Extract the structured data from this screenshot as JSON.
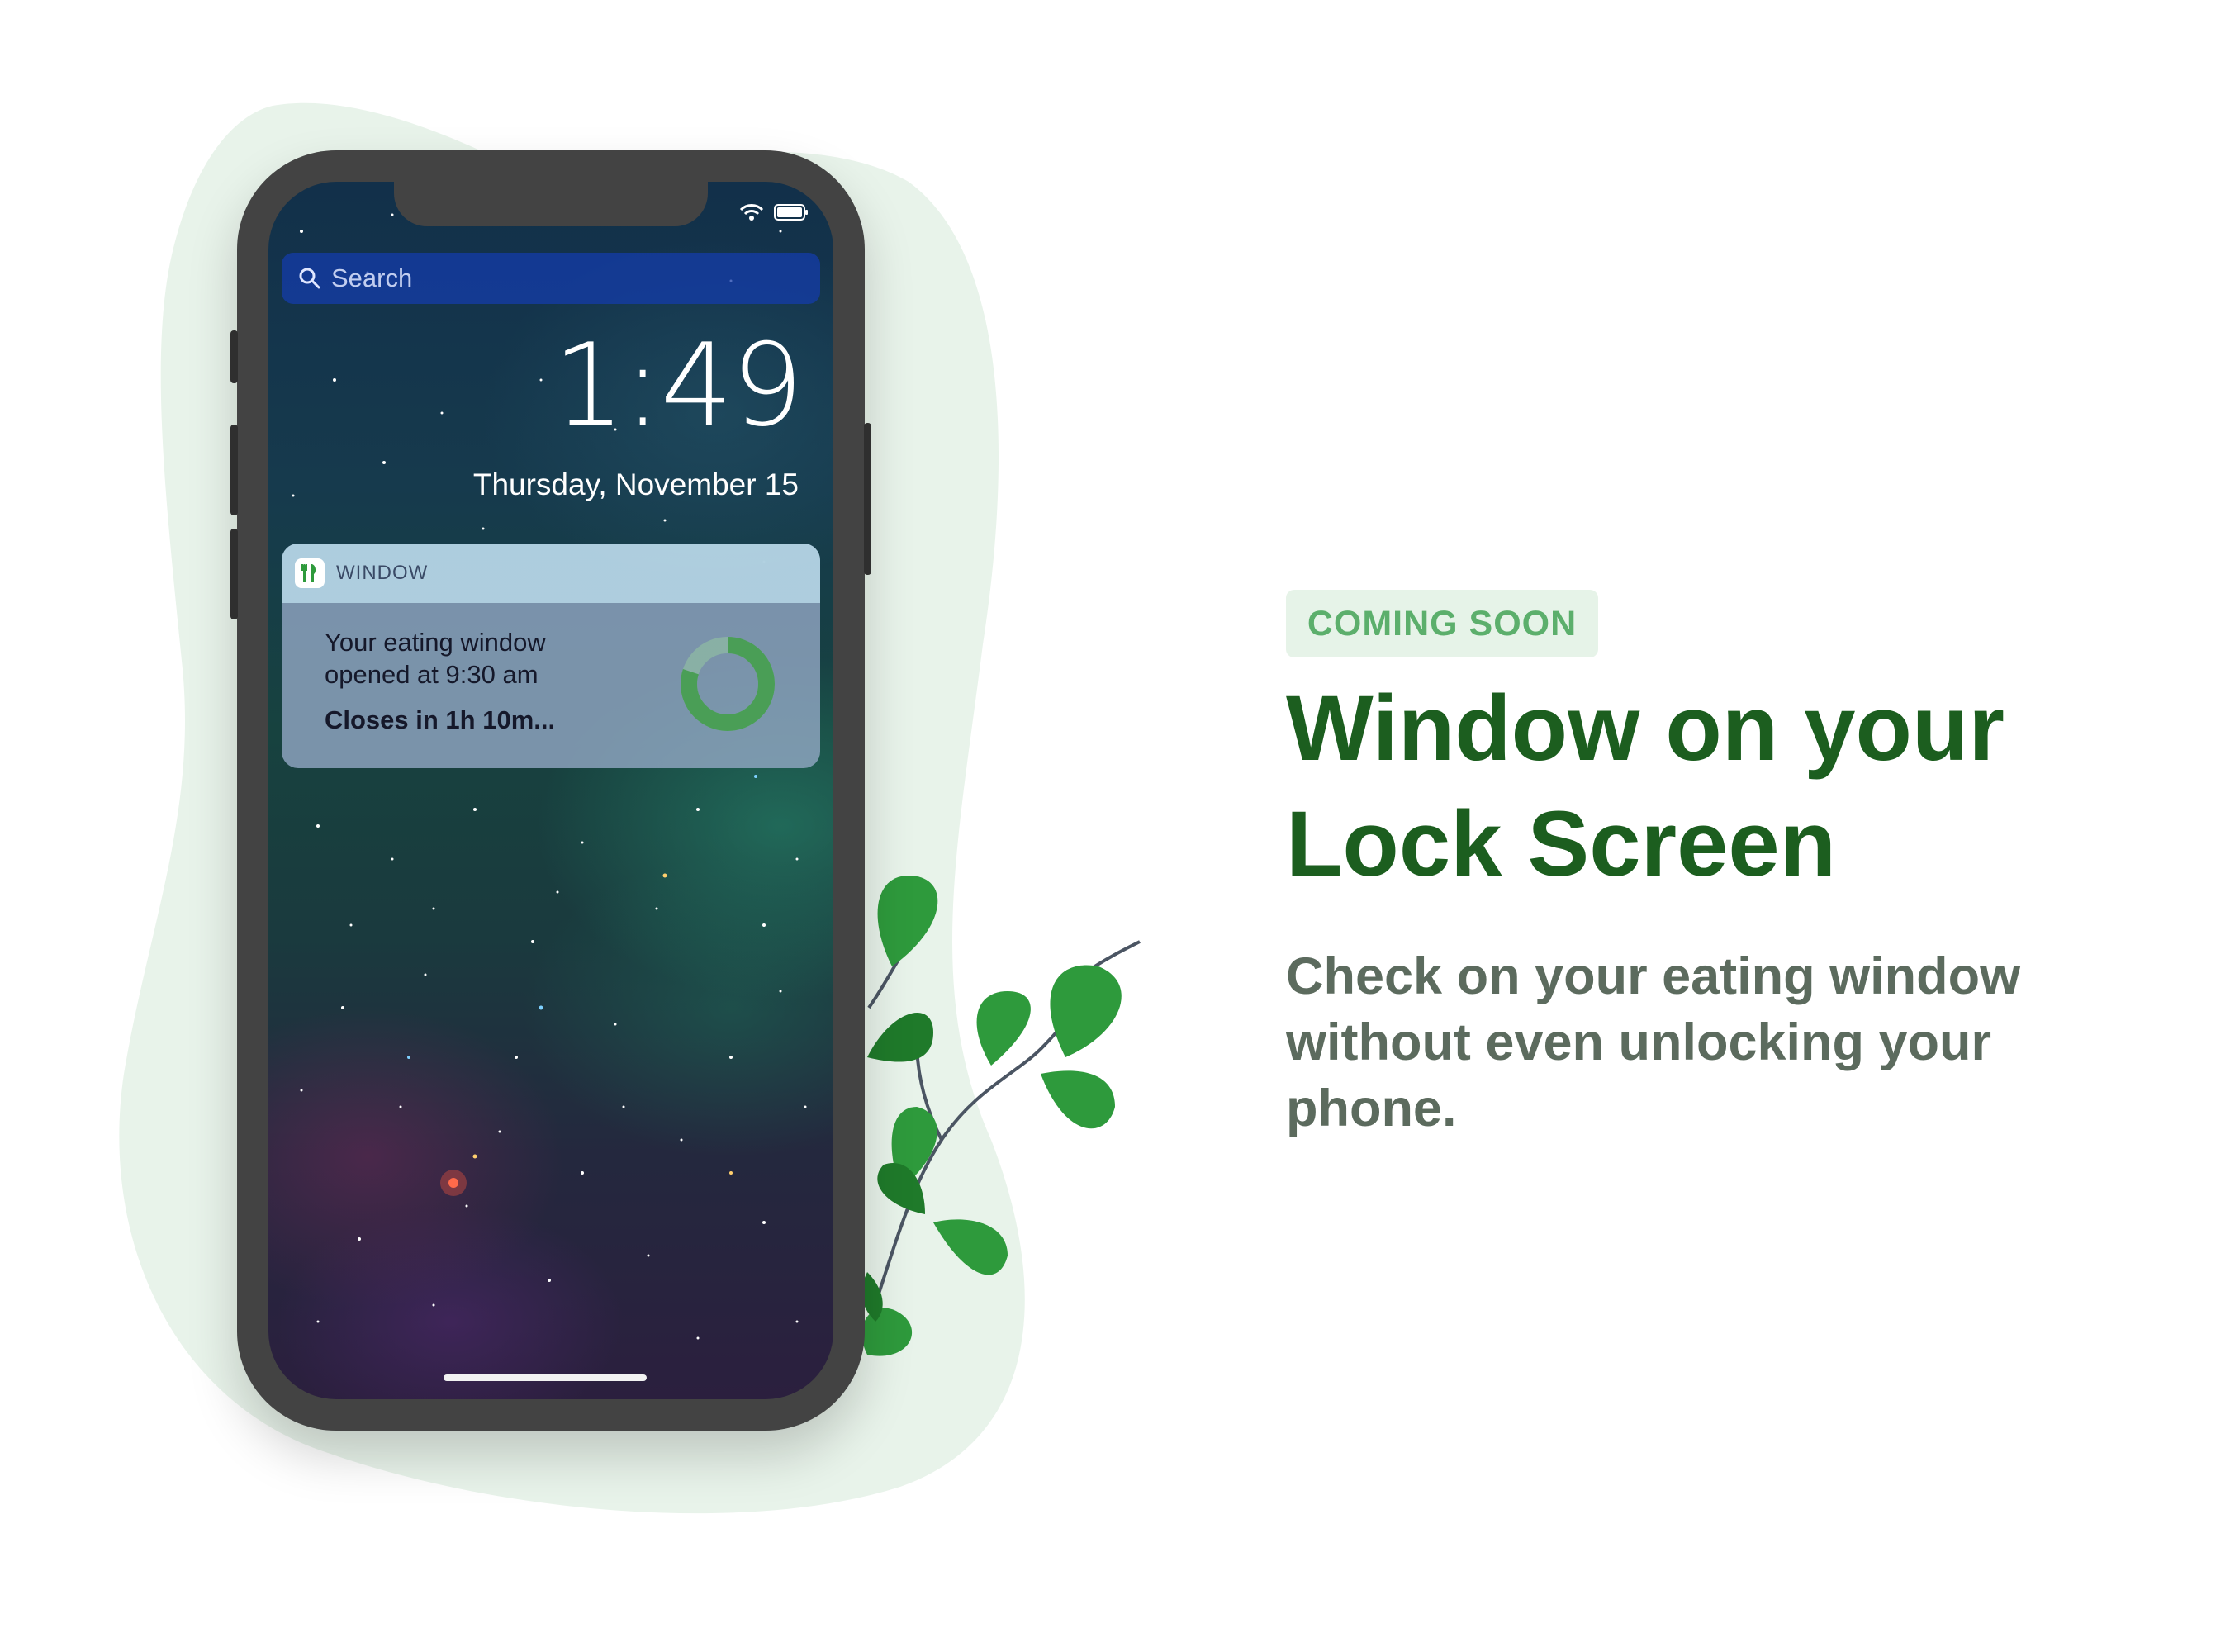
{
  "colors": {
    "accent_green": "#1c5e1f",
    "badge_text": "#5caf6c",
    "badge_bg": "#e6f3e8",
    "blob": "#e8f3ea",
    "leaf_dark": "#1f7a2a",
    "leaf_light": "#2e9a3c",
    "body_text": "#5c6b5e",
    "progress_ring": "#4a9e56"
  },
  "phone": {
    "search": {
      "icon": "search-icon",
      "placeholder": "Search"
    },
    "status_icons": [
      "wifi-icon",
      "battery-icon"
    ],
    "clock": "1:49",
    "date": "Thursday, November 15",
    "notification": {
      "app_icon": "fork-knife-icon",
      "app_name": "WINDOW",
      "line1": "Your eating window",
      "line2": "opened at 9:30 am",
      "emphasis": "Closes in 1h 10m...",
      "progress_fraction": 0.8
    }
  },
  "promo": {
    "badge": "COMING SOON",
    "headline_line1": "Window on your",
    "headline_line2": "Lock Screen",
    "subcopy": "Check on your eating window without even unlocking your phone."
  }
}
